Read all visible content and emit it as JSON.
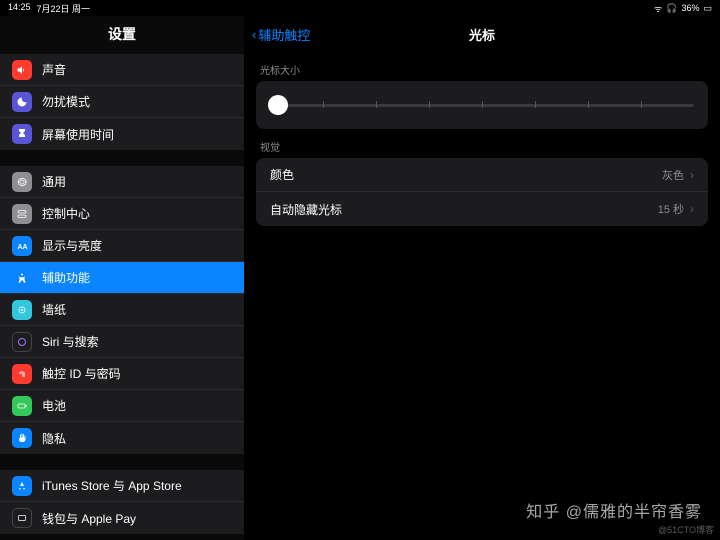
{
  "status": {
    "time": "14:25",
    "date": "7月22日 周一",
    "battery": "36%"
  },
  "sidebar": {
    "title": "设置",
    "g1": [
      {
        "label": "声音",
        "color": "#ff3b30"
      },
      {
        "label": "勿扰模式",
        "color": "#5856d6"
      },
      {
        "label": "屏幕使用时间",
        "color": "#5856d6"
      }
    ],
    "g2": [
      {
        "label": "通用",
        "color": "#8e8e93"
      },
      {
        "label": "控制中心",
        "color": "#8e8e93"
      },
      {
        "label": "显示与亮度",
        "color": "#0a84ff"
      },
      {
        "label": "辅助功能",
        "color": "#0a84ff",
        "selected": true
      },
      {
        "label": "墙纸",
        "color": "#33c7de"
      },
      {
        "label": "Siri 与搜索",
        "color": "#1c1c1e"
      },
      {
        "label": "触控 ID 与密码",
        "color": "#ff3b30"
      },
      {
        "label": "电池",
        "color": "#34c759"
      },
      {
        "label": "隐私",
        "color": "#0a84ff"
      }
    ],
    "g3": [
      {
        "label": "iTunes Store 与 App Store",
        "color": "#0a84ff"
      },
      {
        "label": "钱包与 Apple Pay",
        "color": "#8e8e93"
      }
    ]
  },
  "detail": {
    "back": "辅助触控",
    "title": "光标",
    "slider_header": "光标大小",
    "visual_header": "视觉",
    "rows": [
      {
        "label": "颜色",
        "value": "灰色"
      },
      {
        "label": "自动隐藏光标",
        "value": "15 秒"
      }
    ]
  },
  "watermark1": "知乎  @儒雅的半帘香雾",
  "watermark2": "@51CTO博客"
}
